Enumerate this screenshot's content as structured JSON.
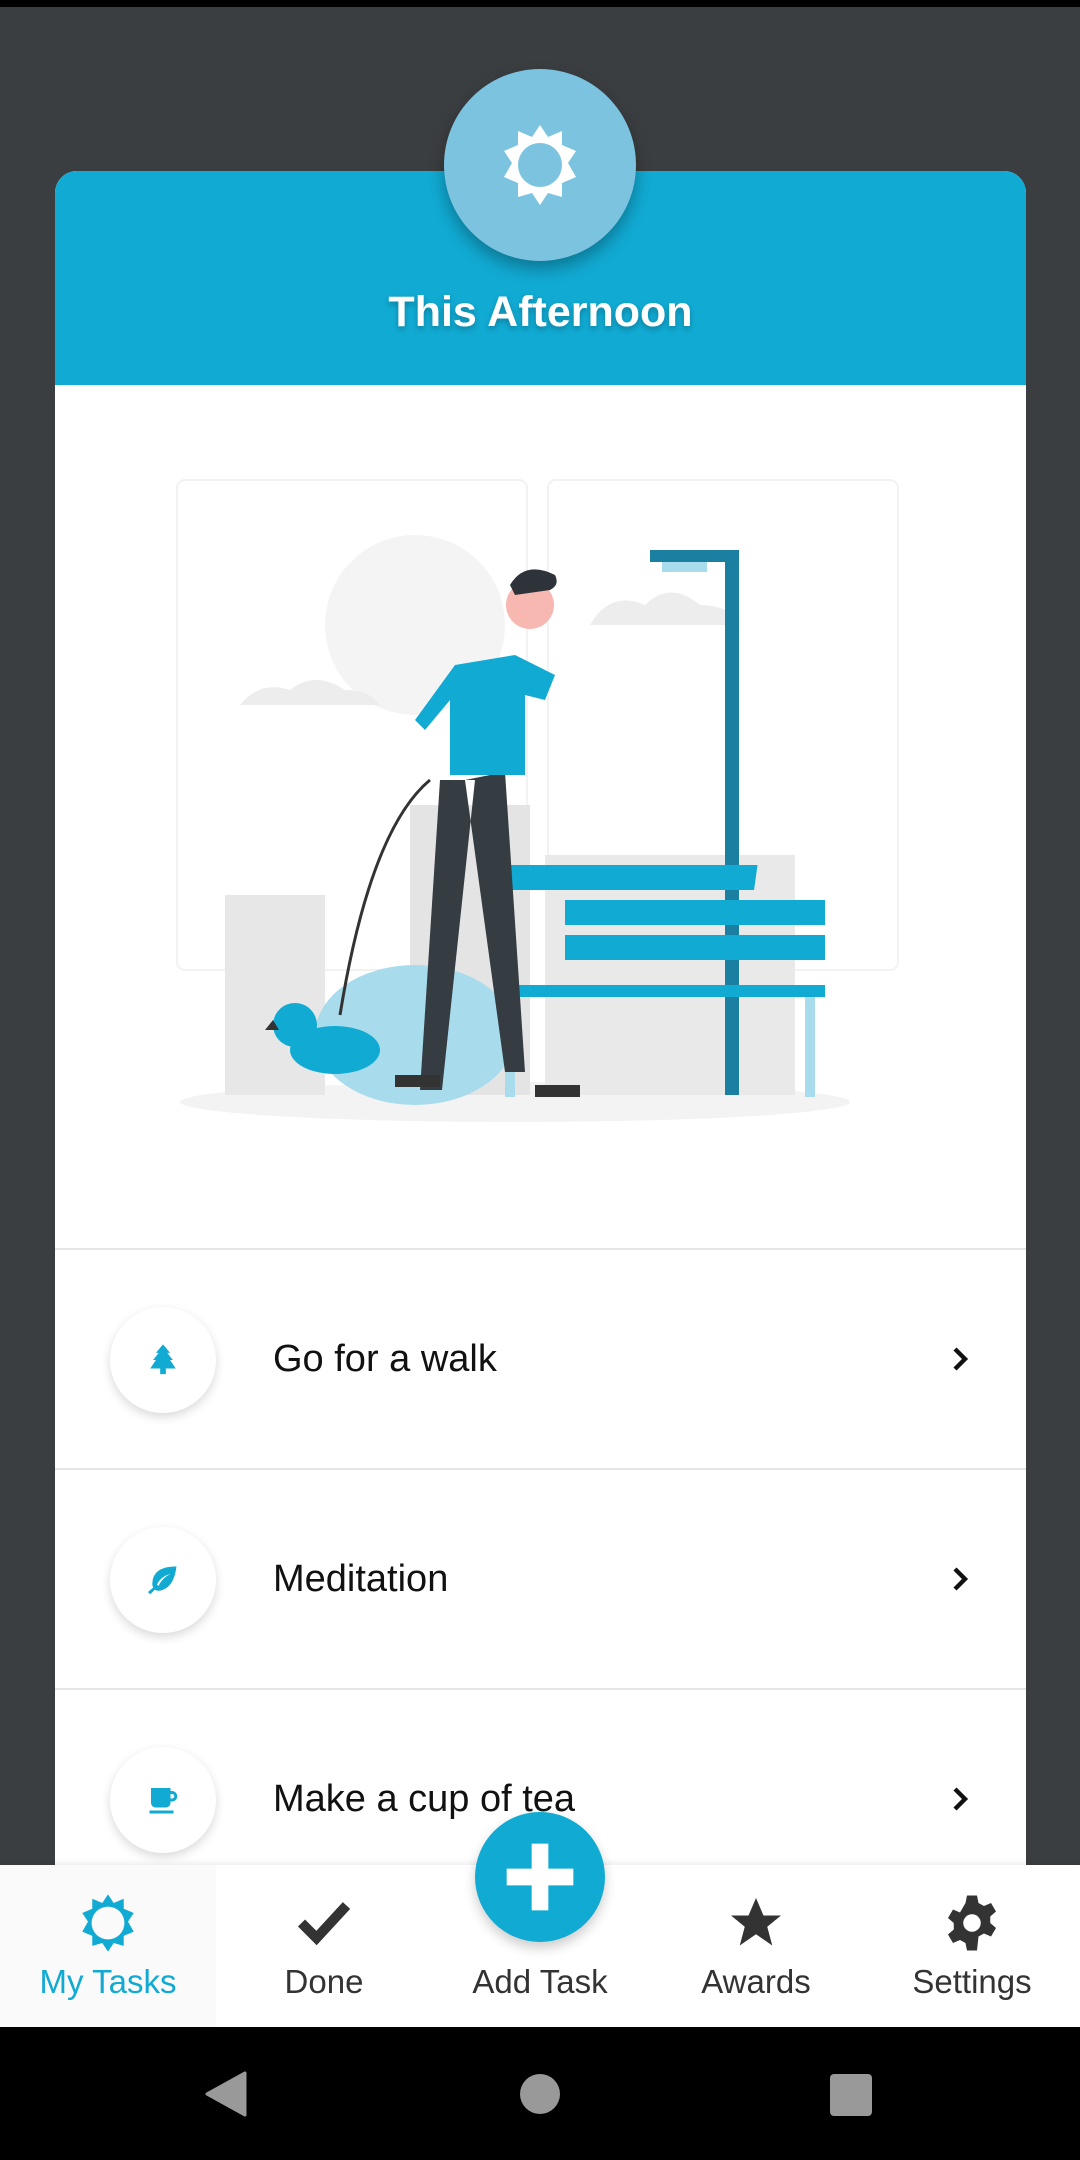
{
  "header": {
    "title": "This Afternoon",
    "icon": "sun-icon"
  },
  "tasks": [
    {
      "label": "Go for a walk",
      "icon": "tree-icon"
    },
    {
      "label": "Meditation",
      "icon": "leaf-icon"
    },
    {
      "label": "Make a cup of tea",
      "icon": "cup-icon"
    }
  ],
  "nav": {
    "items": [
      {
        "label": "My Tasks",
        "icon": "sun-icon",
        "active": true
      },
      {
        "label": "Done",
        "icon": "check-icon"
      },
      {
        "label": "Add Task",
        "icon": "plus-icon"
      },
      {
        "label": "Awards",
        "icon": "star-icon"
      },
      {
        "label": "Settings",
        "icon": "gear-icon"
      }
    ]
  },
  "colors": {
    "accent": "#11aad3",
    "badge": "#7cc3e0",
    "background": "#3b3e40",
    "dark_icon": "#333333"
  }
}
